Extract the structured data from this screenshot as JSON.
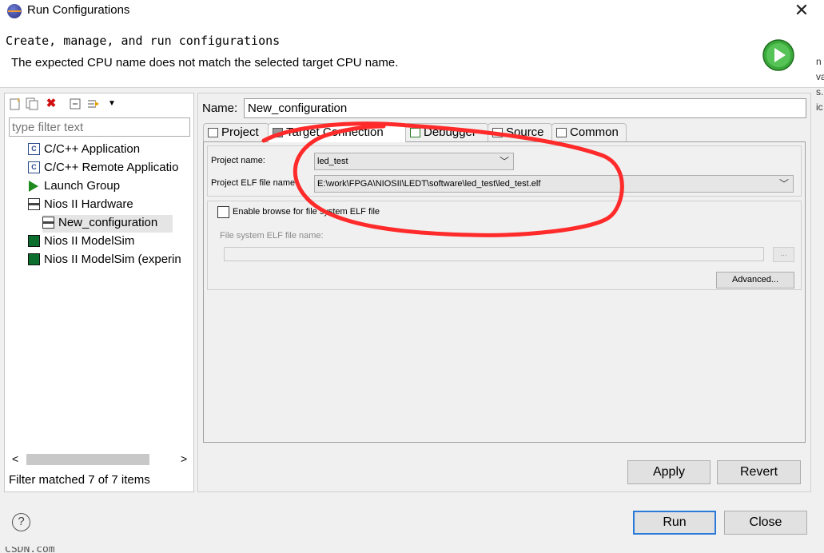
{
  "window": {
    "title": "Run Configurations",
    "close_glyph": "✕"
  },
  "header": {
    "title": "Create, manage, and run configurations",
    "message": "The expected CPU name does not match the selected target CPU name.",
    "right_strip_chars": [
      "n",
      "va",
      "s.",
      "ic"
    ]
  },
  "left": {
    "filter_placeholder": "type filter text",
    "tree": [
      {
        "label": "C/C++ Application",
        "icon": "c-app-icon",
        "indent": 0
      },
      {
        "label": "C/C++ Remote Applicatio",
        "icon": "c-remote-app-icon",
        "indent": 0
      },
      {
        "label": "Launch Group",
        "icon": "launch-group-icon",
        "indent": 0
      },
      {
        "label": "Nios II Hardware",
        "icon": "nios-hardware-icon",
        "indent": 0
      },
      {
        "label": "New_configuration",
        "icon": "nios-config-icon",
        "indent": 1,
        "selected": true
      },
      {
        "label": "Nios II ModelSim",
        "icon": "modelsim-icon",
        "indent": 0
      },
      {
        "label": "Nios II ModelSim (experin",
        "icon": "modelsim-icon",
        "indent": 0
      }
    ],
    "status": "Filter matched 7 of 7 items"
  },
  "right": {
    "name_label": "Name:",
    "name_value": "New_configuration",
    "tabs": [
      {
        "label": "Project",
        "icon": "project-tab-icon"
      },
      {
        "label": "Target Connection",
        "icon": "target-connection-tab-icon",
        "active": true
      },
      {
        "label": "Debugger",
        "icon": "debugger-tab-icon"
      },
      {
        "label": "Source",
        "icon": "source-tab-icon"
      },
      {
        "label": "Common",
        "icon": "common-tab-icon"
      }
    ],
    "project_name_label": "Project name:",
    "project_name_value": "led_test",
    "elf_label": "Project ELF file name",
    "elf_value": "E:\\work\\FPGA\\NIOSII\\LEDT\\software\\led_test\\led_test.elf",
    "enable_browse_label": "Enable browse for file system ELF file",
    "enable_browse_checked": false,
    "fs_elf_label": "File system ELF file name:",
    "fs_elf_value": "",
    "browse_button": "...",
    "advanced_button": "Advanced...",
    "apply_button": "Apply",
    "revert_button": "Revert"
  },
  "footer": {
    "run_button": "Run",
    "close_button": "Close",
    "help_glyph": "?",
    "watermark_text": "CSDN.com"
  },
  "colors": {
    "accent_border": "#2a7ad8",
    "annotation_red": "#ff2a2a",
    "run_icon_green": "#3aa83a"
  }
}
